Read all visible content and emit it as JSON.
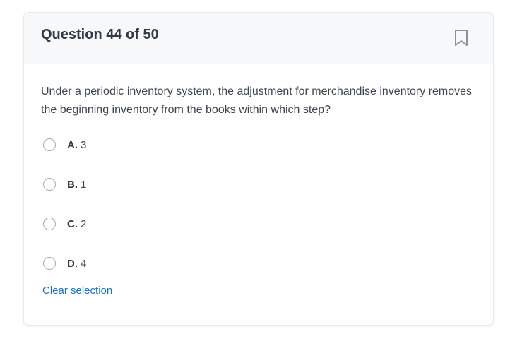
{
  "question": {
    "title": "Question 44 of 50",
    "text": "Under a periodic inventory system, the adjustment for merchandise inventory removes the beginning inventory from the books within which step?",
    "bookmark_icon": "bookmark-icon",
    "options": [
      {
        "letter": "A.",
        "text": "3",
        "selected": false
      },
      {
        "letter": "B.",
        "text": "1",
        "selected": false
      },
      {
        "letter": "C.",
        "text": "2",
        "selected": false
      },
      {
        "letter": "D.",
        "text": "4",
        "selected": false
      }
    ],
    "clear_label": "Clear selection"
  },
  "colors": {
    "header_bg": "#f7f8fa",
    "title": "#2f3a45",
    "body_text": "#3d4650",
    "link": "#1a73c8",
    "radio_border": "#a3aab2",
    "bookmark": "#8a939c"
  }
}
